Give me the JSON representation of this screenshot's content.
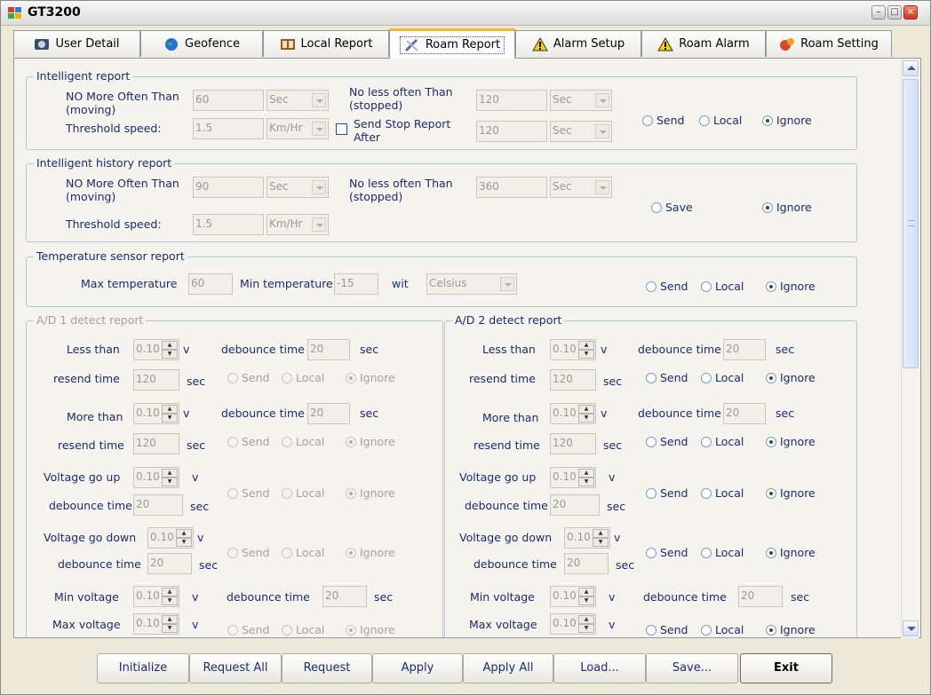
{
  "window": {
    "title": "GT3200",
    "min_glyph": "–",
    "max_glyph": "□",
    "close_glyph": "×"
  },
  "tabs": [
    {
      "label": "User Detail",
      "icon": "user-detail-icon"
    },
    {
      "label": "Geofence",
      "icon": "geofence-icon"
    },
    {
      "label": "Local Report",
      "icon": "local-report-icon"
    },
    {
      "label": "Roam Report",
      "icon": "roam-report-icon",
      "active": true
    },
    {
      "label": "Alarm Setup",
      "icon": "warning-icon"
    },
    {
      "label": "Roam Alarm",
      "icon": "warning-icon"
    },
    {
      "label": "Roam Setting",
      "icon": "roam-setting-icon"
    }
  ],
  "radio_labels": {
    "send": "Send",
    "local": "Local",
    "ignore": "Ignore",
    "save": "Save"
  },
  "intelligent": {
    "title": "Intelligent report",
    "no_more_label": "NO More Often Than\n(moving)",
    "no_more_value": "60",
    "no_more_unit": "Sec",
    "no_less_label": "No less often Than\n(stopped)",
    "no_less_value": "120",
    "no_less_unit": "Sec",
    "threshold_label": "Threshold speed:",
    "threshold_value": "1.5",
    "threshold_unit": "Km/Hr",
    "stop_label": "Send Stop Report\nAfter",
    "stop_value": "120",
    "stop_unit": "Sec",
    "selected": "ignore"
  },
  "history": {
    "title": "Intelligent history report",
    "no_more_label": "NO More Often Than\n(moving)",
    "no_more_value": "90",
    "no_more_unit": "Sec",
    "no_less_label": "No less often Than\n(stopped)",
    "no_less_value": "360",
    "no_less_unit": "Sec",
    "threshold_label": "Threshold speed:",
    "threshold_value": "1.5",
    "threshold_unit": "Km/Hr",
    "selected": "ignore"
  },
  "temperature": {
    "title": "Temperature sensor report",
    "max_label": "Max temperature",
    "max_value": "60",
    "min_label": "Min temperature",
    "min_value": "-15",
    "unit_label": "wit",
    "unit_value": "Celsius",
    "selected": "ignore"
  },
  "ad_labels": {
    "less_than": "Less than",
    "more_than": "More than",
    "resend_time": "resend time",
    "debounce_time": "debounce time",
    "voltage_up": "Voltage go up",
    "voltage_down": "Voltage go down",
    "min_voltage": "Min voltage",
    "max_voltage": "Max voltage",
    "unit_v": "v",
    "unit_sec": "sec"
  },
  "ad1": {
    "title": "A/D 1 detect report",
    "less_value": "0.10",
    "less_debounce": "20",
    "less_resend": "120",
    "more_value": "0.10",
    "more_debounce": "20",
    "more_resend": "120",
    "up_value": "0.10",
    "up_debounce": "20",
    "down_value": "0.10",
    "down_debounce": "20",
    "min_value": "0.10",
    "min_debounce": "20",
    "max_value": "0.10"
  },
  "ad2": {
    "title": "A/D 2 detect report",
    "less_value": "0.10",
    "less_debounce": "20",
    "less_resend": "120",
    "more_value": "0.10",
    "more_debounce": "20",
    "more_resend": "120",
    "up_value": "0.10",
    "up_debounce": "20",
    "down_value": "0.10",
    "down_debounce": "20",
    "min_value": "0.10",
    "min_debounce": "20",
    "max_value": "0.10"
  },
  "buttons": {
    "initialize": "Initialize",
    "request_all": "Request All",
    "request": "Request",
    "apply": "Apply",
    "apply_all": "Apply All",
    "load": "Load...",
    "save": "Save...",
    "exit": "Exit"
  },
  "colors": {
    "accent_tab": "#f5b731",
    "label_text": "#1f2a6b",
    "disabled_text": "#9e9e9e"
  }
}
